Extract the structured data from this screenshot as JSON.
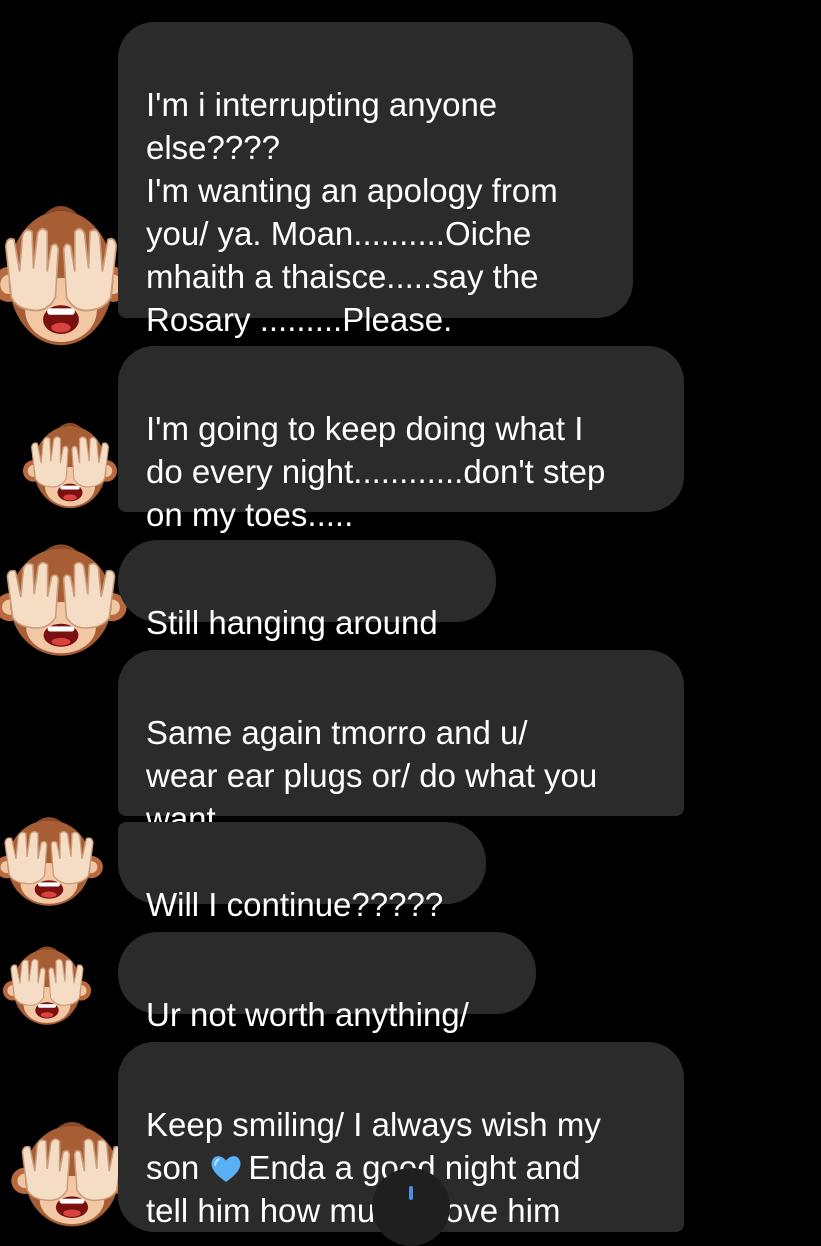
{
  "colors": {
    "background": "#000000",
    "bubble": "#2b2b2b",
    "text": "#ffffff"
  },
  "messages": [
    {
      "text": "I'm i interrupting anyone\nelse????\nI'm wanting an apology from\nyou/ ya. Moan..........Oiche\nmhaith a thaisce.....say the\nRosary .........Please.",
      "avatar": "see-no-evil-monkey-icon"
    },
    {
      "text": "I'm going to keep doing what I\ndo every night............don't step\non my toes.....",
      "avatar": "see-no-evil-monkey-icon"
    },
    {
      "text": "Still hanging around",
      "avatar": "see-no-evil-monkey-icon"
    },
    {
      "text": "Same again  tmorro and u/\nwear ear plugs or/ do what you\nwant."
    },
    {
      "text": "Will I continue?????",
      "avatar": "see-no-evil-monkey-icon"
    },
    {
      "text": "Ur not worth anything/",
      "avatar": "see-no-evil-monkey-icon"
    },
    {
      "text_before_emoji": "Keep smiling/ I always wish my\nson ",
      "emoji": "blue-heart-icon",
      "text_after_emoji": "Enda a good night and\ntell him how much I love him",
      "avatar": "see-no-evil-monkey-icon"
    }
  ],
  "scroll_button": {
    "icon": "scroll-to-bottom-icon"
  }
}
